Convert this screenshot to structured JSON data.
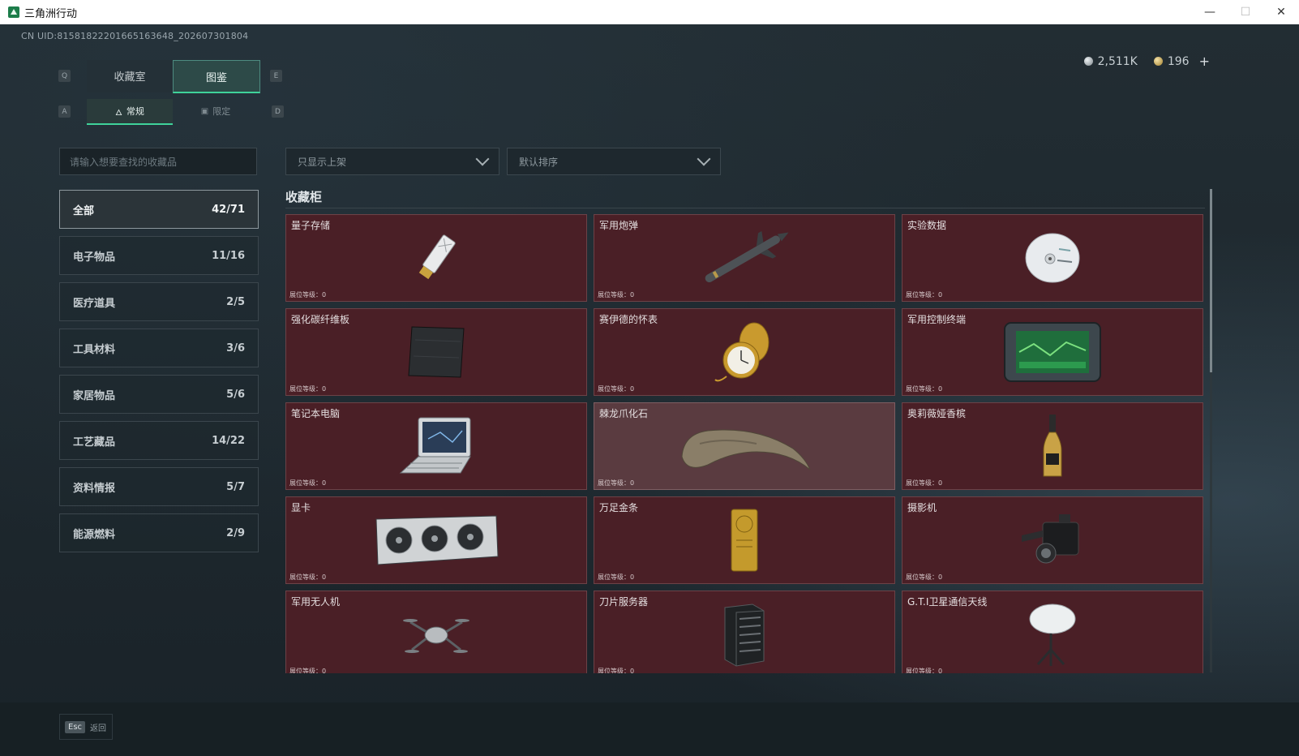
{
  "window": {
    "title": "三角洲行动",
    "minimize": "—",
    "maximize": "☐",
    "close": "✕"
  },
  "header": {
    "uid": "CN UID:8158182220166516364​8_202607301804",
    "currency": {
      "silver": "2,511K",
      "gold": "196",
      "add": "+"
    }
  },
  "keys": {
    "q": "Q",
    "e": "E",
    "a": "A",
    "d": "D",
    "esc": "Esc"
  },
  "tabs_main": [
    {
      "label": "收藏室",
      "active": false
    },
    {
      "label": "图鉴",
      "active": true
    }
  ],
  "tabs_sub": [
    {
      "label": "常规",
      "icon": "flame-icon",
      "active": true
    },
    {
      "label": "限定",
      "icon": "image-icon",
      "active": false
    }
  ],
  "search": {
    "placeholder": "请输入想要查找的收藏品"
  },
  "filters": {
    "show_filter": "只显示上架",
    "sort": "默认排序"
  },
  "categories": [
    {
      "label": "全部",
      "count": "42/71",
      "active": true
    },
    {
      "label": "电子物品",
      "count": "11/16"
    },
    {
      "label": "医疗道具",
      "count": "2/5"
    },
    {
      "label": "工具材料",
      "count": "3/6"
    },
    {
      "label": "家居物品",
      "count": "5/6"
    },
    {
      "label": "工艺藏品",
      "count": "14/22"
    },
    {
      "label": "资料情报",
      "count": "5/7"
    },
    {
      "label": "能源燃料",
      "count": "2/9"
    }
  ],
  "section_title": "收藏柜",
  "items": [
    {
      "name": "量子存储",
      "level": "展位等级：0",
      "icon": "usb-drive-icon"
    },
    {
      "name": "军用炮弹",
      "level": "展位等级：0",
      "icon": "missile-icon"
    },
    {
      "name": "实验数据",
      "level": "展位等级：0",
      "icon": "disc-icon"
    },
    {
      "name": "强化碳纤维板",
      "level": "展位等级：0",
      "icon": "carbon-plate-icon"
    },
    {
      "name": "赛伊德的怀表",
      "level": "展位等级：0",
      "icon": "pocket-watch-icon"
    },
    {
      "name": "军用控制终端",
      "level": "展位等级：0",
      "icon": "terminal-icon"
    },
    {
      "name": "笔记本电脑",
      "level": "展位等级：0",
      "icon": "laptop-icon"
    },
    {
      "name": "棘龙爪化石",
      "level": "展位等级：0",
      "icon": "claw-fossil-icon"
    },
    {
      "name": "奥莉薇娅香槟",
      "level": "展位等级：0",
      "icon": "champagne-icon"
    },
    {
      "name": "显卡",
      "level": "展位等级：0",
      "icon": "graphics-card-icon"
    },
    {
      "name": "万足金条",
      "level": "展位等级：0",
      "icon": "gold-bar-icon"
    },
    {
      "name": "摄影机",
      "level": "展位等级：0",
      "icon": "camera-icon"
    },
    {
      "name": "军用无人机",
      "level": "展位等级：0",
      "icon": "drone-icon"
    },
    {
      "name": "刀片服务器",
      "level": "展位等级：0",
      "icon": "server-icon"
    },
    {
      "name": "G.T.I卫星通信天线",
      "level": "展位等级：0",
      "icon": "satellite-dish-icon"
    }
  ],
  "footer": {
    "back_label": "返回"
  },
  "colors": {
    "accent": "#3fd29a",
    "card_bg": "#4a1f26",
    "card_highlight": "#5a3b40"
  }
}
